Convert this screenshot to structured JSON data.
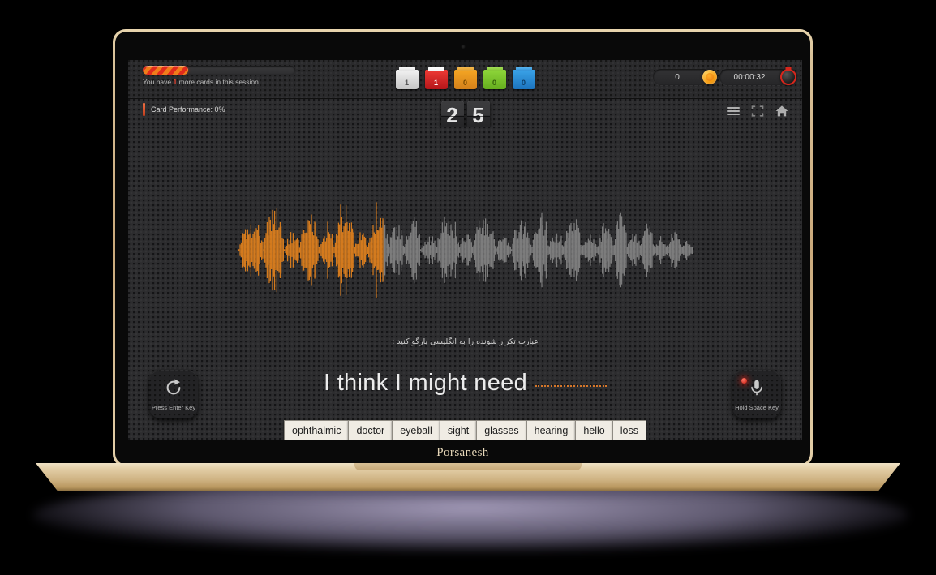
{
  "device": {
    "brand_label": "Porsanesh",
    "webcam_icon": "webcam-dot"
  },
  "topbar": {
    "session_progress_percent": 30,
    "session_note_prefix": "You have",
    "session_note_count": "1",
    "session_note_suffix": "more cards in this session",
    "counters": [
      {
        "id": "new",
        "value": "1",
        "color": "#f2f2f2",
        "style": "cb-white"
      },
      {
        "id": "again",
        "value": "1",
        "color": "#ef3b35",
        "style": "cb-red"
      },
      {
        "id": "hard",
        "value": "0",
        "color": "#f5a623",
        "style": "cb-orange"
      },
      {
        "id": "good",
        "value": "0",
        "color": "#8ed63a",
        "style": "cb-green"
      },
      {
        "id": "easy",
        "value": "0",
        "color": "#3aa3e8",
        "style": "cb-blue"
      }
    ],
    "score_value": "0",
    "score_icon": "coin-icon",
    "timer_value": "00:00:32",
    "timer_icon": "stopwatch-icon"
  },
  "subbar": {
    "card_performance_label": "Card Performance: 0%",
    "flip_counter_digits": [
      "2",
      "5"
    ],
    "nav_icons": [
      "menu-icon",
      "fullscreen-icon",
      "home-icon"
    ]
  },
  "stage": {
    "waveform": {
      "played_color": "#f0881c",
      "remaining_color": "#8a8a8a",
      "played_fraction": 0.32
    },
    "prompt_fa": "عبارت تکرار شونده را به انگلیسی بازگو کنید :",
    "sentence": "I think I might need",
    "blank_style": "dotted-underline",
    "blank_color": "#d4762a",
    "word_chips": [
      "ophthalmic",
      "doctor",
      "eyeball",
      "sight",
      "glasses",
      "hearing",
      "hello",
      "loss"
    ],
    "replay_button": {
      "label": "Press Enter Key",
      "icon": "replay-icon"
    },
    "mic_button": {
      "label": "Hold Space Key",
      "icon": "microphone-icon",
      "led": "recording-led"
    }
  }
}
